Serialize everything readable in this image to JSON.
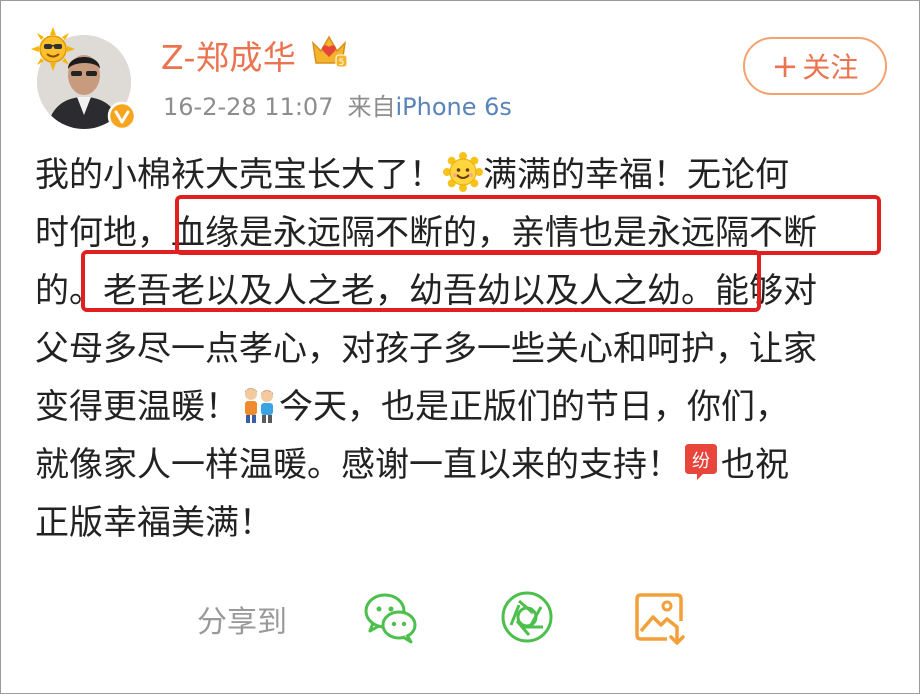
{
  "post": {
    "username": "Z-郑成华",
    "timestamp": "16-2-28 11:07",
    "source_prefix": "来自",
    "device": "iPhone 6s",
    "follow_label": "关注",
    "follow_plus": "+",
    "lines": [
      {
        "a": "我的小棉袄大壳宝长大了！",
        "b": "满满的幸福！无论何"
      },
      {
        "a": "时何地，血缘是永远隔不断的，亲情也是永远隔不断"
      },
      {
        "a": "的。老吾老以及人之老，幼吾幼以及人之幼。能够对"
      },
      {
        "a": "父母多尽一点孝心，对孩子多一些关心和呵护，让家"
      },
      {
        "a": "变得更温暖！",
        "b": "今天，也是正版们的节日，你们，"
      },
      {
        "a": "就像家人一样温暖。感谢一直以来的支持！",
        "b": "也祝"
      },
      {
        "a": "正版幸福美满！"
      }
    ],
    "highlights": [
      "血缘是永远隔不断的，亲情也是永远隔不断",
      "老吾老以及人之老，幼吾幼以及人之幼。"
    ],
    "gongdou_badge": "纷"
  },
  "share": {
    "label": "分享到",
    "targets": [
      "wechat-icon",
      "moments-icon",
      "save-image-icon"
    ]
  },
  "colors": {
    "accent": "#eb7350",
    "link": "#5a84b8",
    "highlight_box": "#e02020",
    "share_green": "#4cbf4c",
    "share_orange": "#f3a03a"
  }
}
